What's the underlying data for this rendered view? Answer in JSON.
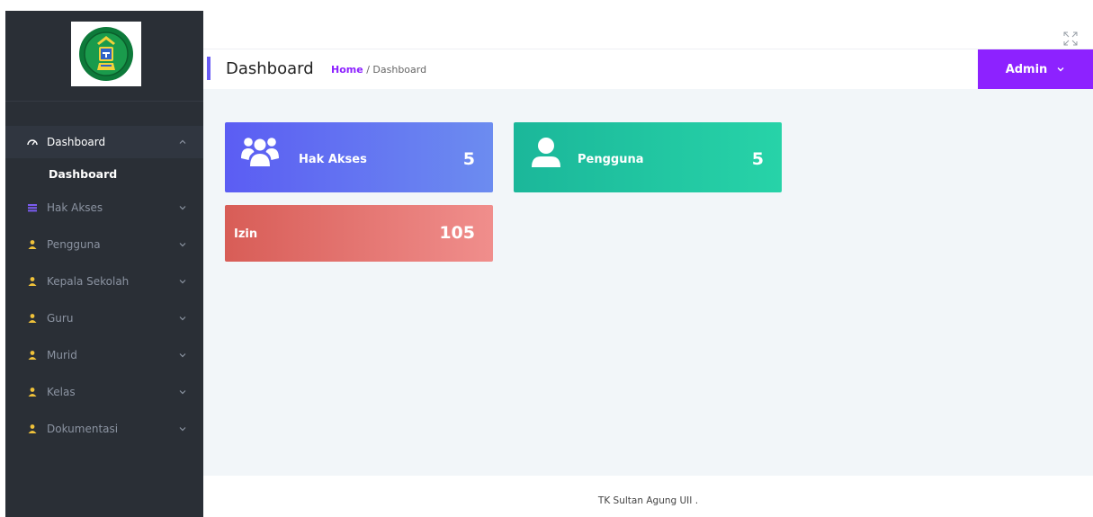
{
  "sidebar": {
    "logo": "school-emblem",
    "items": [
      {
        "label": "Dashboard",
        "icon": "dashboard-icon",
        "expanded": true
      },
      {
        "label": "Hak Akses",
        "icon": "list-icon"
      },
      {
        "label": "Pengguna",
        "icon": "user-icon"
      },
      {
        "label": "Kepala Sekolah",
        "icon": "user-icon"
      },
      {
        "label": "Guru",
        "icon": "user-icon"
      },
      {
        "label": "Murid",
        "icon": "user-icon"
      },
      {
        "label": "Kelas",
        "icon": "user-icon"
      },
      {
        "label": "Dokumentasi",
        "icon": "user-icon"
      }
    ],
    "submenu": {
      "label": "Dashboard"
    }
  },
  "header": {
    "title": "Dashboard",
    "breadcrumb_home": "Home",
    "breadcrumb_sep": "/",
    "breadcrumb_current": "Dashboard",
    "user_menu": "Admin"
  },
  "cards": {
    "hak_akses": {
      "label": "Hak Akses",
      "value": "5",
      "icon": "users-icon"
    },
    "pengguna": {
      "label": "Pengguna",
      "value": "5",
      "icon": "user-icon"
    },
    "izin": {
      "label": "Izin",
      "value": "105"
    }
  },
  "footer": {
    "text": "TK Sultan Agung UII ."
  },
  "colors": {
    "sidebar_bg": "#2a2f36",
    "accent": "#8d22ff",
    "card_hak": "#5b5df3",
    "card_pengguna": "#1bb79a",
    "card_izin": "#d85d57",
    "content_bg": "#f2f6f9"
  }
}
